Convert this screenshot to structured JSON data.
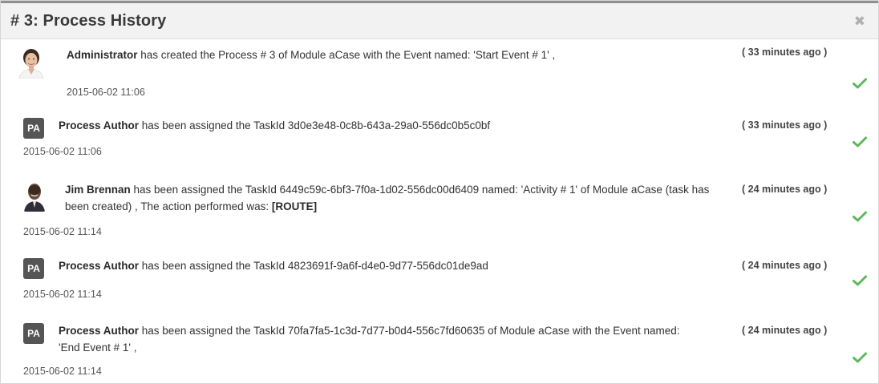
{
  "dialog": {
    "title": "# 3: Process History",
    "close_icon": "close-icon"
  },
  "entries": [
    {
      "actor": "Administrator",
      "avatar": "administrator-photo",
      "message": " has created the Process # 3 of Module aCase with the Event named: 'Start Event # 1' ,",
      "time_ago": "( 33 minutes ago )",
      "date": "2015-06-02 11:06",
      "status_icon": "check-icon"
    },
    {
      "actor": "Process Author",
      "avatar_text": "PA",
      "message": " has been assigned the TaskId 3d0e3e48-0c8b-643a-29a0-556dc0b5c0bf",
      "time_ago": "( 33 minutes ago )",
      "date": "2015-06-02 11:06",
      "status_icon": "check-icon"
    },
    {
      "actor": "Jim Brennan",
      "avatar": "jim-brennan-photo",
      "message": " has been assigned the TaskId 6449c59c-6bf3-7f0a-1d02-556dc00d6409 named: 'Activity # 1' of Module aCase (task has been created) , The action performed was: ",
      "action": "[ROUTE]",
      "time_ago": "( 24 minutes ago )",
      "date": "2015-06-02 11:14",
      "status_icon": "check-icon"
    },
    {
      "actor": "Process Author",
      "avatar_text": "PA",
      "message": " has been assigned the TaskId 4823691f-9a6f-d4e0-9d77-556dc01de9ad",
      "time_ago": "( 24 minutes ago )",
      "date": "2015-06-02 11:14",
      "status_icon": "check-icon"
    },
    {
      "actor": "Process Author",
      "avatar_text": "PA",
      "message": " has been assigned the TaskId 70fa7fa5-1c3d-7d77-b0d4-556c7fd60635 of Module aCase with the Event named: 'End Event # 1' ,",
      "time_ago": "( 24 minutes ago )",
      "date": "2015-06-02 11:14",
      "status_icon": "check-icon"
    }
  ],
  "colors": {
    "check": "#5cb85c",
    "pa_badge": "#555555",
    "header_bg": "#f2f2f2"
  }
}
